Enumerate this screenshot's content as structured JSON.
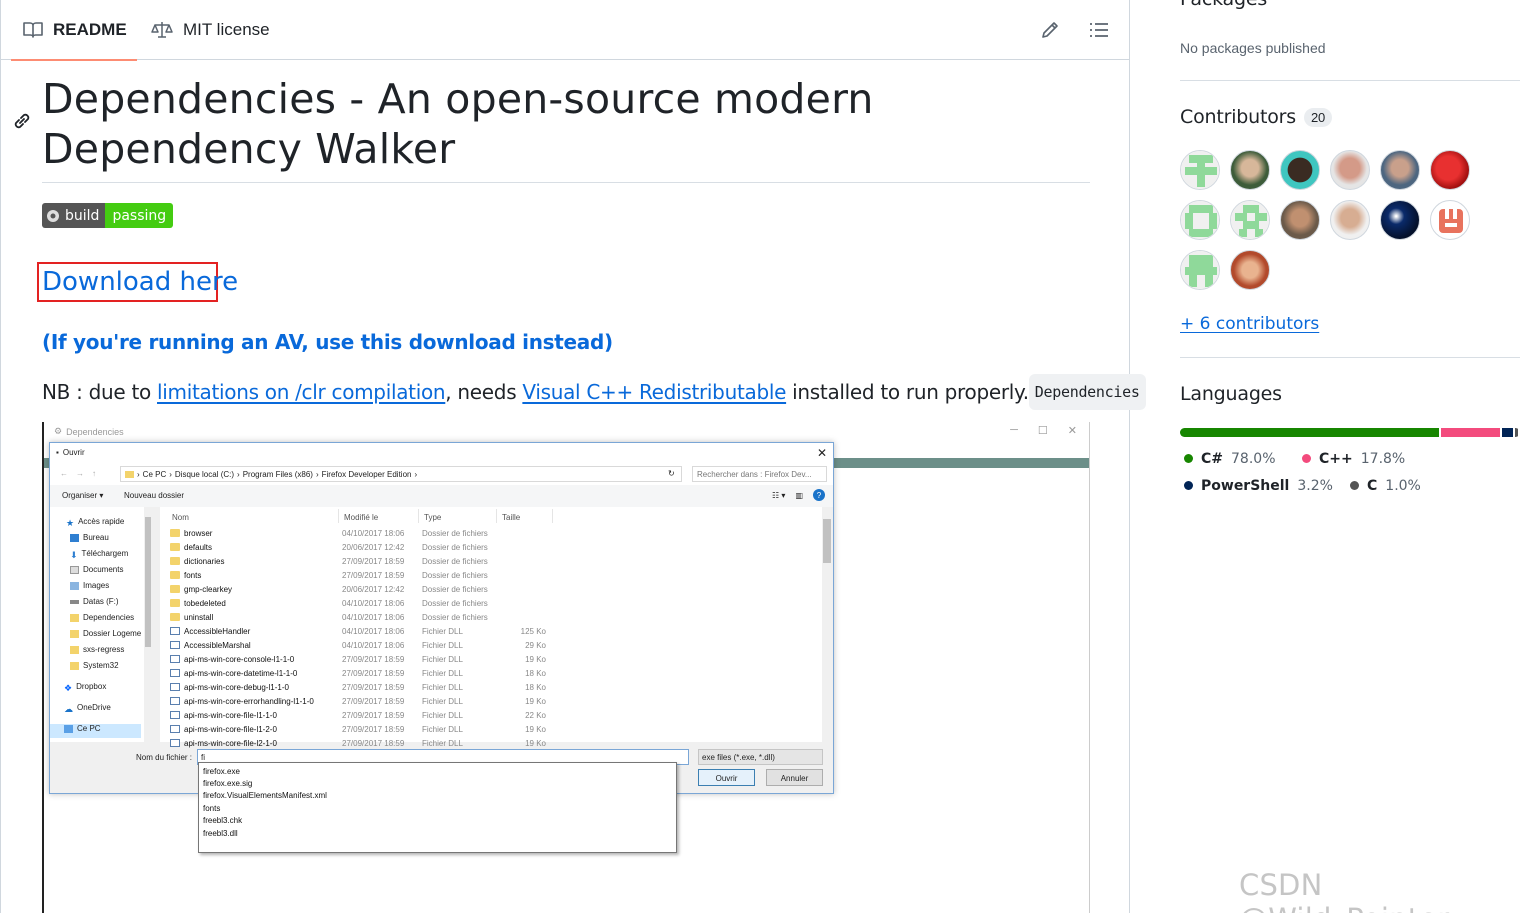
{
  "tabs": {
    "readme": "README",
    "license": "MIT license"
  },
  "readme": {
    "title": "Dependencies - An open-source modern Dependency Walker",
    "badge_left": "build",
    "badge_right": "passing",
    "download_link": "Download here",
    "av_link": "(If you're running an AV, use this download instead)",
    "nb_prefix": "NB : due to ",
    "nb_link1": "limitations on /clr compilation",
    "nb_mid": ", needs ",
    "nb_link2": "Visual C++ Redistributable",
    "nb_suffix": " installed to run properly.",
    "nb_code": "Dependencies"
  },
  "screenshot": {
    "main_title": "Dependencies",
    "dialog_title": "Ouvrir",
    "breadcrumb": [
      "Ce PC",
      "Disque local (C:)",
      "Program Files (x86)",
      "Firefox Developer Edition"
    ],
    "search_placeholder": "Rechercher dans : Firefox Dev...",
    "toolbar": {
      "organize": "Organiser ▾",
      "new_folder": "Nouveau dossier"
    },
    "nav_items": [
      "Accès rapide",
      "Bureau",
      "Téléchargem",
      "Documents",
      "Images",
      "Datas (F:)",
      "Dependencies",
      "Dossier Logeme",
      "sxs-regress",
      "System32",
      "Dropbox",
      "OneDrive",
      "Ce PC"
    ],
    "columns": {
      "name": "Nom",
      "modified": "Modifié le",
      "type": "Type",
      "size": "Taille"
    },
    "files": [
      {
        "name": "browser",
        "date": "04/10/2017 18:06",
        "type": "Dossier de fichiers",
        "size": "",
        "kind": "folder"
      },
      {
        "name": "defaults",
        "date": "20/06/2017 12:42",
        "type": "Dossier de fichiers",
        "size": "",
        "kind": "folder"
      },
      {
        "name": "dictionaries",
        "date": "27/09/2017 18:59",
        "type": "Dossier de fichiers",
        "size": "",
        "kind": "folder"
      },
      {
        "name": "fonts",
        "date": "27/09/2017 18:59",
        "type": "Dossier de fichiers",
        "size": "",
        "kind": "folder"
      },
      {
        "name": "gmp-clearkey",
        "date": "20/06/2017 12:42",
        "type": "Dossier de fichiers",
        "size": "",
        "kind": "folder"
      },
      {
        "name": "tobedeleted",
        "date": "04/10/2017 18:06",
        "type": "Dossier de fichiers",
        "size": "",
        "kind": "folder"
      },
      {
        "name": "uninstall",
        "date": "04/10/2017 18:06",
        "type": "Dossier de fichiers",
        "size": "",
        "kind": "folder"
      },
      {
        "name": "AccessibleHandler",
        "date": "04/10/2017 18:06",
        "type": "Fichier DLL",
        "size": "125 Ko",
        "kind": "dll"
      },
      {
        "name": "AccessibleMarshal",
        "date": "04/10/2017 18:06",
        "type": "Fichier DLL",
        "size": "29 Ko",
        "kind": "dll"
      },
      {
        "name": "api-ms-win-core-console-l1-1-0",
        "date": "27/09/2017 18:59",
        "type": "Fichier DLL",
        "size": "19 Ko",
        "kind": "dll"
      },
      {
        "name": "api-ms-win-core-datetime-l1-1-0",
        "date": "27/09/2017 18:59",
        "type": "Fichier DLL",
        "size": "18 Ko",
        "kind": "dll"
      },
      {
        "name": "api-ms-win-core-debug-l1-1-0",
        "date": "27/09/2017 18:59",
        "type": "Fichier DLL",
        "size": "18 Ko",
        "kind": "dll"
      },
      {
        "name": "api-ms-win-core-errorhandling-l1-1-0",
        "date": "27/09/2017 18:59",
        "type": "Fichier DLL",
        "size": "19 Ko",
        "kind": "dll"
      },
      {
        "name": "api-ms-win-core-file-l1-1-0",
        "date": "27/09/2017 18:59",
        "type": "Fichier DLL",
        "size": "22 Ko",
        "kind": "dll"
      },
      {
        "name": "api-ms-win-core-file-l1-2-0",
        "date": "27/09/2017 18:59",
        "type": "Fichier DLL",
        "size": "19 Ko",
        "kind": "dll"
      },
      {
        "name": "api-ms-win-core-file-l2-1-0",
        "date": "27/09/2017 18:59",
        "type": "Fichier DLL",
        "size": "19 Ko",
        "kind": "dll"
      }
    ],
    "filename_label": "Nom du fichier :",
    "filename_value": "fi",
    "filter": "exe files (*.exe, *.dll)",
    "open_button": "Ouvrir",
    "cancel_button": "Annuler",
    "autocomplete": [
      "firefox.exe",
      "firefox.exe.sig",
      "firefox.VisualElementsManifest.xml",
      "fonts",
      "freebl3.chk",
      "freebl3.dll"
    ]
  },
  "sidebar": {
    "packages_title": "Packages",
    "packages_text": "No packages published",
    "contributors_title": "Contributors",
    "contributors_count": "20",
    "more_contributors": "+ 6 contributors",
    "languages_title": "Languages",
    "languages": [
      {
        "name": "C#",
        "pct": "78.0%",
        "value": 78.0,
        "color": "#178600"
      },
      {
        "name": "C++",
        "pct": "17.8%",
        "value": 17.8,
        "color": "#f34b7d"
      },
      {
        "name": "PowerShell",
        "pct": "3.2%",
        "value": 3.2,
        "color": "#012456"
      },
      {
        "name": "C",
        "pct": "1.0%",
        "value": 1.0,
        "color": "#555555"
      }
    ]
  },
  "watermark": "CSDN @Wild_Pointer."
}
